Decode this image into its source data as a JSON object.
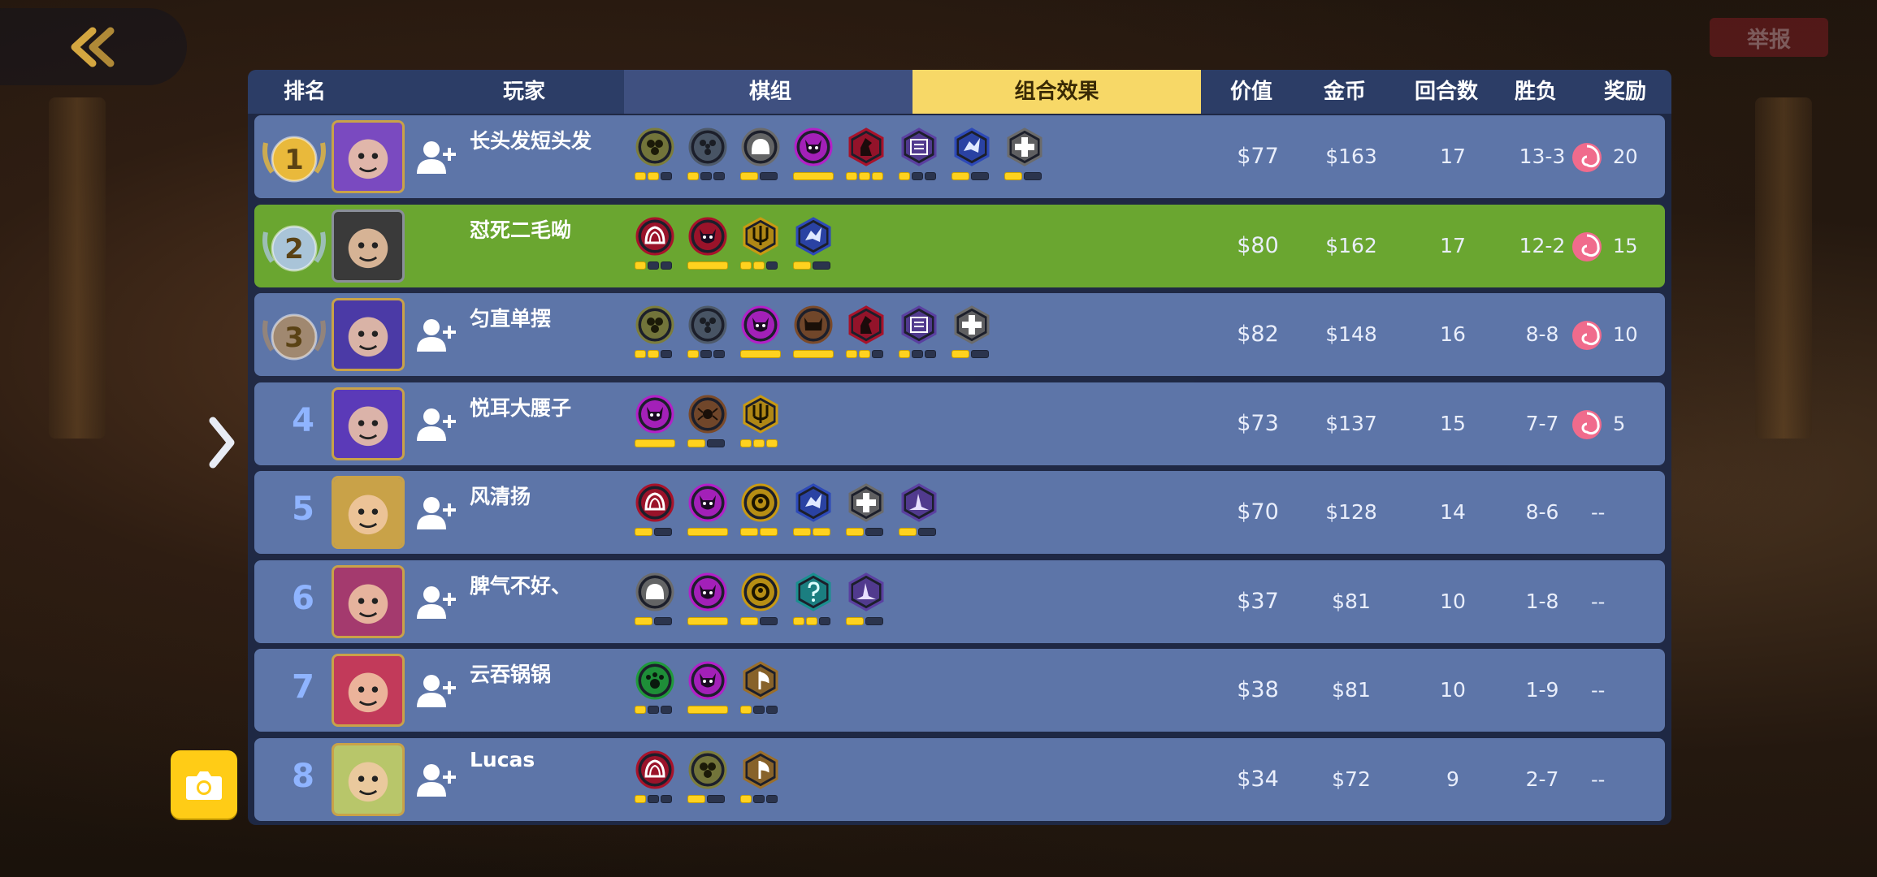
{
  "top": {
    "report_label": "举报"
  },
  "header": {
    "rank": "排名",
    "player": "玩家",
    "lineup_tab": "棋组",
    "effects_tab": "组合效果",
    "value": "价值",
    "gold": "金币",
    "rounds": "回合数",
    "record": "胜负",
    "reward": "奖励"
  },
  "rows": [
    {
      "rank": "1",
      "name": "长头发短头发",
      "value": "$77",
      "gold": "$163",
      "rounds": "17",
      "record": "13-3",
      "reward": "20"
    },
    {
      "rank": "2",
      "name": "怼死二毛呦",
      "value": "$80",
      "gold": "$162",
      "rounds": "17",
      "record": "12-2",
      "reward": "15"
    },
    {
      "rank": "3",
      "name": "匀直单摆",
      "value": "$82",
      "gold": "$148",
      "rounds": "16",
      "record": "8-8",
      "reward": "10"
    },
    {
      "rank": "4",
      "name": "悦耳大腰子",
      "value": "$73",
      "gold": "$137",
      "rounds": "15",
      "record": "7-7",
      "reward": "5"
    },
    {
      "rank": "5",
      "name": "风清扬",
      "value": "$70",
      "gold": "$128",
      "rounds": "14",
      "record": "8-6",
      "reward": "--"
    },
    {
      "rank": "6",
      "name": "脾气不好、",
      "value": "$37",
      "gold": "$81",
      "rounds": "10",
      "record": "1-8",
      "reward": "--"
    },
    {
      "rank": "7",
      "name": "云吞锅锅",
      "value": "$38",
      "gold": "$81",
      "rounds": "10",
      "record": "1-9",
      "reward": "--"
    },
    {
      "rank": "8",
      "name": "Lucas",
      "value": "$34",
      "gold": "$72",
      "rounds": "9",
      "record": "2-7",
      "reward": "--"
    }
  ],
  "synergy_colors": {
    "olive": "#7c7d3c",
    "slate": "#4e5a6a",
    "grey": "#6b6b6b",
    "magenta": "#b320c8",
    "crimson": "#a8122a",
    "purple": "#5a3fa0",
    "blue": "#2d49b8",
    "gold": "#c99a12",
    "brown": "#7a4a2a",
    "teal": "#1b8f8f",
    "green": "#1f9a3a",
    "bronze": "#9a6e2a"
  },
  "synergies": [
    [
      {
        "icon": "beetle-icon",
        "color": "olive",
        "shape": "circle",
        "pips": 3,
        "on": 2
      },
      {
        "icon": "cluster-icon",
        "color": "slate",
        "shape": "circle",
        "pips": 3,
        "on": 1
      },
      {
        "icon": "helmet-icon",
        "color": "grey",
        "shape": "circle",
        "pips": 2,
        "on": 1
      },
      {
        "icon": "demon-icon",
        "color": "magenta",
        "shape": "circle",
        "pips": 1,
        "on": 1
      },
      {
        "icon": "knight-icon",
        "color": "crimson",
        "shape": "hex",
        "pips": 3,
        "on": 3
      },
      {
        "icon": "book-icon",
        "color": "purple",
        "shape": "hex",
        "pips": 3,
        "on": 1
      },
      {
        "icon": "dragon-icon",
        "color": "blue",
        "shape": "hex",
        "pips": 2,
        "on": 1
      },
      {
        "icon": "cross-icon",
        "color": "grey",
        "shape": "hex",
        "pips": 2,
        "on": 1
      }
    ],
    [
      {
        "icon": "flame-icon",
        "color": "crimson",
        "shape": "circle",
        "pips": 3,
        "on": 1
      },
      {
        "icon": "demon-horn-icon",
        "color": "crimson",
        "shape": "circle",
        "pips": 1,
        "on": 1
      },
      {
        "icon": "trident-icon",
        "color": "gold",
        "shape": "hex",
        "pips": 3,
        "on": 2
      },
      {
        "icon": "dragon-icon",
        "color": "blue",
        "shape": "hex",
        "pips": 2,
        "on": 1
      }
    ],
    [
      {
        "icon": "beetle-icon",
        "color": "olive",
        "shape": "circle",
        "pips": 3,
        "on": 2
      },
      {
        "icon": "cluster-icon",
        "color": "slate",
        "shape": "circle",
        "pips": 3,
        "on": 1
      },
      {
        "icon": "demon-icon",
        "color": "magenta",
        "shape": "circle",
        "pips": 1,
        "on": 1
      },
      {
        "icon": "cat-icon",
        "color": "brown",
        "shape": "circle",
        "pips": 1,
        "on": 1
      },
      {
        "icon": "knight-icon",
        "color": "crimson",
        "shape": "hex",
        "pips": 3,
        "on": 2
      },
      {
        "icon": "book-icon",
        "color": "purple",
        "shape": "hex",
        "pips": 3,
        "on": 1
      },
      {
        "icon": "cross-icon",
        "color": "grey",
        "shape": "hex",
        "pips": 2,
        "on": 1
      }
    ],
    [
      {
        "icon": "demon-icon",
        "color": "magenta",
        "shape": "circle",
        "pips": 1,
        "on": 1
      },
      {
        "icon": "spider-icon",
        "color": "brown",
        "shape": "circle",
        "pips": 2,
        "on": 1
      },
      {
        "icon": "trident-icon",
        "color": "gold",
        "shape": "hex",
        "pips": 3,
        "on": 3
      }
    ],
    [
      {
        "icon": "flame-icon",
        "color": "crimson",
        "shape": "circle",
        "pips": 2,
        "on": 1
      },
      {
        "icon": "demon-icon",
        "color": "magenta",
        "shape": "circle",
        "pips": 1,
        "on": 1
      },
      {
        "icon": "ring-icon",
        "color": "gold",
        "shape": "circle",
        "pips": 2,
        "on": 2
      },
      {
        "icon": "dragon-icon",
        "color": "blue",
        "shape": "hex",
        "pips": 2,
        "on": 2
      },
      {
        "icon": "cross-icon",
        "color": "grey",
        "shape": "hex",
        "pips": 2,
        "on": 1
      },
      {
        "icon": "wizard-hat-icon",
        "color": "purple",
        "shape": "hex",
        "pips": 2,
        "on": 1
      }
    ],
    [
      {
        "icon": "helmet-icon",
        "color": "grey",
        "shape": "circle",
        "pips": 2,
        "on": 1
      },
      {
        "icon": "demon-icon",
        "color": "magenta",
        "shape": "circle",
        "pips": 1,
        "on": 1
      },
      {
        "icon": "ring-icon",
        "color": "gold",
        "shape": "circle",
        "pips": 2,
        "on": 1
      },
      {
        "icon": "question-icon",
        "color": "teal",
        "shape": "hex",
        "pips": 3,
        "on": 2
      },
      {
        "icon": "wizard-hat-icon",
        "color": "purple",
        "shape": "hex",
        "pips": 2,
        "on": 1
      }
    ],
    [
      {
        "icon": "paw-icon",
        "color": "green",
        "shape": "circle",
        "pips": 3,
        "on": 1
      },
      {
        "icon": "demon-icon",
        "color": "magenta",
        "shape": "circle",
        "pips": 1,
        "on": 1
      },
      {
        "icon": "axe-icon",
        "color": "bronze",
        "shape": "hex",
        "pips": 3,
        "on": 1
      }
    ],
    [
      {
        "icon": "flame-icon",
        "color": "crimson",
        "shape": "circle",
        "pips": 3,
        "on": 1
      },
      {
        "icon": "clover-icon",
        "color": "olive",
        "shape": "circle",
        "pips": 2,
        "on": 1
      },
      {
        "icon": "axe-icon",
        "color": "bronze",
        "shape": "hex",
        "pips": 3,
        "on": 1
      }
    ]
  ],
  "avatar_colors": [
    "#7a4ac0",
    "#3a3a3a",
    "#4b3aa6",
    "#5b3ab8",
    "#c9a248",
    "#a43a6e",
    "#c23a5a",
    "#b8c66a"
  ]
}
